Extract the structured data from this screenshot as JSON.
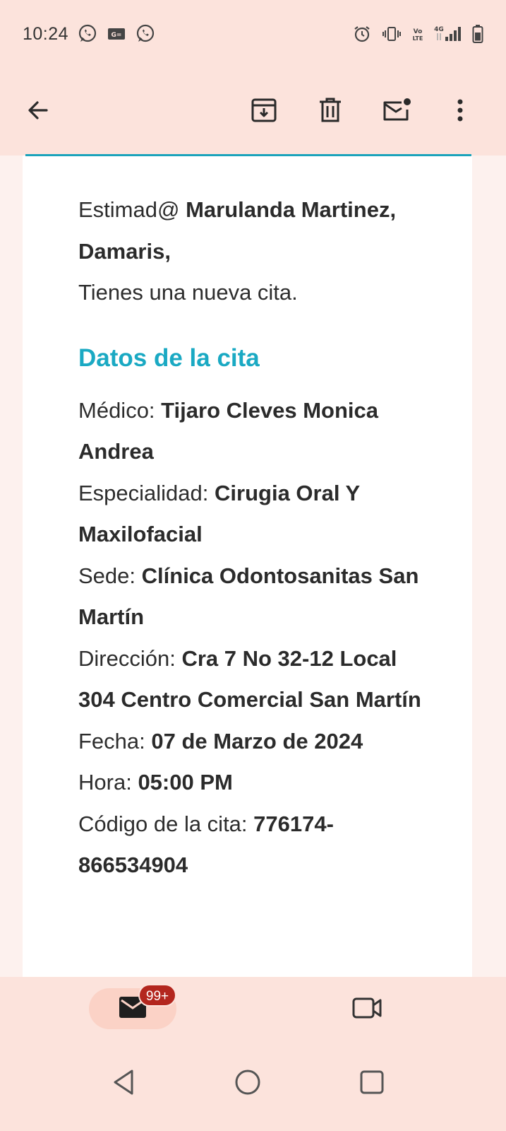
{
  "status_bar": {
    "time": "10:24",
    "left_icons": [
      "whatsapp-icon",
      "gmail-notification-icon",
      "whatsapp-icon"
    ],
    "right_icons": [
      "alarm-icon",
      "vibrate-icon",
      "volte-icon",
      "4g-signal-icon",
      "battery-icon"
    ],
    "volte_label": "Vo\nLTE",
    "network_label": "4G"
  },
  "toolbar": {
    "back_icon": "arrow-left-icon",
    "archive_icon": "archive-icon",
    "delete_icon": "trash-icon",
    "mark_unread_icon": "mail-unread-icon",
    "more_icon": "more-vert-icon"
  },
  "email": {
    "greeting_prefix": "Estimad@",
    "recipient_name": "Marulanda Martinez, Damaris,",
    "intro": "Tienes una nueva cita.",
    "section_title": "Datos de la cita",
    "fields": [
      {
        "label": "Médico:",
        "value": "Tijaro Cleves Monica Andrea"
      },
      {
        "label": "Especialidad:",
        "value": "Cirugia Oral Y Maxilofacial"
      },
      {
        "label": "Sede:",
        "value": "Clínica Odontosanitas San Martín"
      },
      {
        "label": "Dirección:",
        "value": "Cra 7 No 32-12 Local 304 Centro Comercial San Martín"
      },
      {
        "label": "Fecha:",
        "value": "07 de Marzo de 2024"
      },
      {
        "label": "Hora:",
        "value": "05:00 PM"
      },
      {
        "label": "Código de la cita:",
        "value": "776174-866534904"
      }
    ]
  },
  "bottom_nav": {
    "mail_badge": "99+",
    "mail_icon": "mail-icon",
    "meet_icon": "video-camera-icon"
  },
  "system_nav": {
    "back_icon": "triangle-back-icon",
    "home_icon": "circle-home-icon",
    "recents_icon": "square-recents-icon"
  },
  "colors": {
    "accent_teal": "#1aa9c3",
    "chrome_background": "#fce3dc",
    "badge_red": "#b3261e"
  }
}
